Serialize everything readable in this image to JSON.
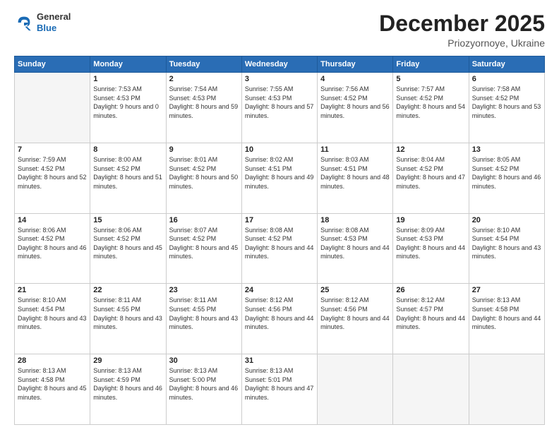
{
  "header": {
    "logo": {
      "general": "General",
      "blue": "Blue"
    },
    "title": "December 2025",
    "location": "Priozyornoye, Ukraine"
  },
  "days_of_week": [
    "Sunday",
    "Monday",
    "Tuesday",
    "Wednesday",
    "Thursday",
    "Friday",
    "Saturday"
  ],
  "weeks": [
    [
      {
        "day": "",
        "sunrise": "",
        "sunset": "",
        "daylight": ""
      },
      {
        "day": "1",
        "sunrise": "Sunrise: 7:53 AM",
        "sunset": "Sunset: 4:53 PM",
        "daylight": "Daylight: 9 hours and 0 minutes."
      },
      {
        "day": "2",
        "sunrise": "Sunrise: 7:54 AM",
        "sunset": "Sunset: 4:53 PM",
        "daylight": "Daylight: 8 hours and 59 minutes."
      },
      {
        "day": "3",
        "sunrise": "Sunrise: 7:55 AM",
        "sunset": "Sunset: 4:53 PM",
        "daylight": "Daylight: 8 hours and 57 minutes."
      },
      {
        "day": "4",
        "sunrise": "Sunrise: 7:56 AM",
        "sunset": "Sunset: 4:52 PM",
        "daylight": "Daylight: 8 hours and 56 minutes."
      },
      {
        "day": "5",
        "sunrise": "Sunrise: 7:57 AM",
        "sunset": "Sunset: 4:52 PM",
        "daylight": "Daylight: 8 hours and 54 minutes."
      },
      {
        "day": "6",
        "sunrise": "Sunrise: 7:58 AM",
        "sunset": "Sunset: 4:52 PM",
        "daylight": "Daylight: 8 hours and 53 minutes."
      }
    ],
    [
      {
        "day": "7",
        "sunrise": "Sunrise: 7:59 AM",
        "sunset": "Sunset: 4:52 PM",
        "daylight": "Daylight: 8 hours and 52 minutes."
      },
      {
        "day": "8",
        "sunrise": "Sunrise: 8:00 AM",
        "sunset": "Sunset: 4:52 PM",
        "daylight": "Daylight: 8 hours and 51 minutes."
      },
      {
        "day": "9",
        "sunrise": "Sunrise: 8:01 AM",
        "sunset": "Sunset: 4:52 PM",
        "daylight": "Daylight: 8 hours and 50 minutes."
      },
      {
        "day": "10",
        "sunrise": "Sunrise: 8:02 AM",
        "sunset": "Sunset: 4:51 PM",
        "daylight": "Daylight: 8 hours and 49 minutes."
      },
      {
        "day": "11",
        "sunrise": "Sunrise: 8:03 AM",
        "sunset": "Sunset: 4:51 PM",
        "daylight": "Daylight: 8 hours and 48 minutes."
      },
      {
        "day": "12",
        "sunrise": "Sunrise: 8:04 AM",
        "sunset": "Sunset: 4:52 PM",
        "daylight": "Daylight: 8 hours and 47 minutes."
      },
      {
        "day": "13",
        "sunrise": "Sunrise: 8:05 AM",
        "sunset": "Sunset: 4:52 PM",
        "daylight": "Daylight: 8 hours and 46 minutes."
      }
    ],
    [
      {
        "day": "14",
        "sunrise": "Sunrise: 8:06 AM",
        "sunset": "Sunset: 4:52 PM",
        "daylight": "Daylight: 8 hours and 46 minutes."
      },
      {
        "day": "15",
        "sunrise": "Sunrise: 8:06 AM",
        "sunset": "Sunset: 4:52 PM",
        "daylight": "Daylight: 8 hours and 45 minutes."
      },
      {
        "day": "16",
        "sunrise": "Sunrise: 8:07 AM",
        "sunset": "Sunset: 4:52 PM",
        "daylight": "Daylight: 8 hours and 45 minutes."
      },
      {
        "day": "17",
        "sunrise": "Sunrise: 8:08 AM",
        "sunset": "Sunset: 4:52 PM",
        "daylight": "Daylight: 8 hours and 44 minutes."
      },
      {
        "day": "18",
        "sunrise": "Sunrise: 8:08 AM",
        "sunset": "Sunset: 4:53 PM",
        "daylight": "Daylight: 8 hours and 44 minutes."
      },
      {
        "day": "19",
        "sunrise": "Sunrise: 8:09 AM",
        "sunset": "Sunset: 4:53 PM",
        "daylight": "Daylight: 8 hours and 44 minutes."
      },
      {
        "day": "20",
        "sunrise": "Sunrise: 8:10 AM",
        "sunset": "Sunset: 4:54 PM",
        "daylight": "Daylight: 8 hours and 43 minutes."
      }
    ],
    [
      {
        "day": "21",
        "sunrise": "Sunrise: 8:10 AM",
        "sunset": "Sunset: 4:54 PM",
        "daylight": "Daylight: 8 hours and 43 minutes."
      },
      {
        "day": "22",
        "sunrise": "Sunrise: 8:11 AM",
        "sunset": "Sunset: 4:55 PM",
        "daylight": "Daylight: 8 hours and 43 minutes."
      },
      {
        "day": "23",
        "sunrise": "Sunrise: 8:11 AM",
        "sunset": "Sunset: 4:55 PM",
        "daylight": "Daylight: 8 hours and 43 minutes."
      },
      {
        "day": "24",
        "sunrise": "Sunrise: 8:12 AM",
        "sunset": "Sunset: 4:56 PM",
        "daylight": "Daylight: 8 hours and 44 minutes."
      },
      {
        "day": "25",
        "sunrise": "Sunrise: 8:12 AM",
        "sunset": "Sunset: 4:56 PM",
        "daylight": "Daylight: 8 hours and 44 minutes."
      },
      {
        "day": "26",
        "sunrise": "Sunrise: 8:12 AM",
        "sunset": "Sunset: 4:57 PM",
        "daylight": "Daylight: 8 hours and 44 minutes."
      },
      {
        "day": "27",
        "sunrise": "Sunrise: 8:13 AM",
        "sunset": "Sunset: 4:58 PM",
        "daylight": "Daylight: 8 hours and 44 minutes."
      }
    ],
    [
      {
        "day": "28",
        "sunrise": "Sunrise: 8:13 AM",
        "sunset": "Sunset: 4:58 PM",
        "daylight": "Daylight: 8 hours and 45 minutes."
      },
      {
        "day": "29",
        "sunrise": "Sunrise: 8:13 AM",
        "sunset": "Sunset: 4:59 PM",
        "daylight": "Daylight: 8 hours and 46 minutes."
      },
      {
        "day": "30",
        "sunrise": "Sunrise: 8:13 AM",
        "sunset": "Sunset: 5:00 PM",
        "daylight": "Daylight: 8 hours and 46 minutes."
      },
      {
        "day": "31",
        "sunrise": "Sunrise: 8:13 AM",
        "sunset": "Sunset: 5:01 PM",
        "daylight": "Daylight: 8 hours and 47 minutes."
      },
      {
        "day": "",
        "sunrise": "",
        "sunset": "",
        "daylight": ""
      },
      {
        "day": "",
        "sunrise": "",
        "sunset": "",
        "daylight": ""
      },
      {
        "day": "",
        "sunrise": "",
        "sunset": "",
        "daylight": ""
      }
    ]
  ]
}
